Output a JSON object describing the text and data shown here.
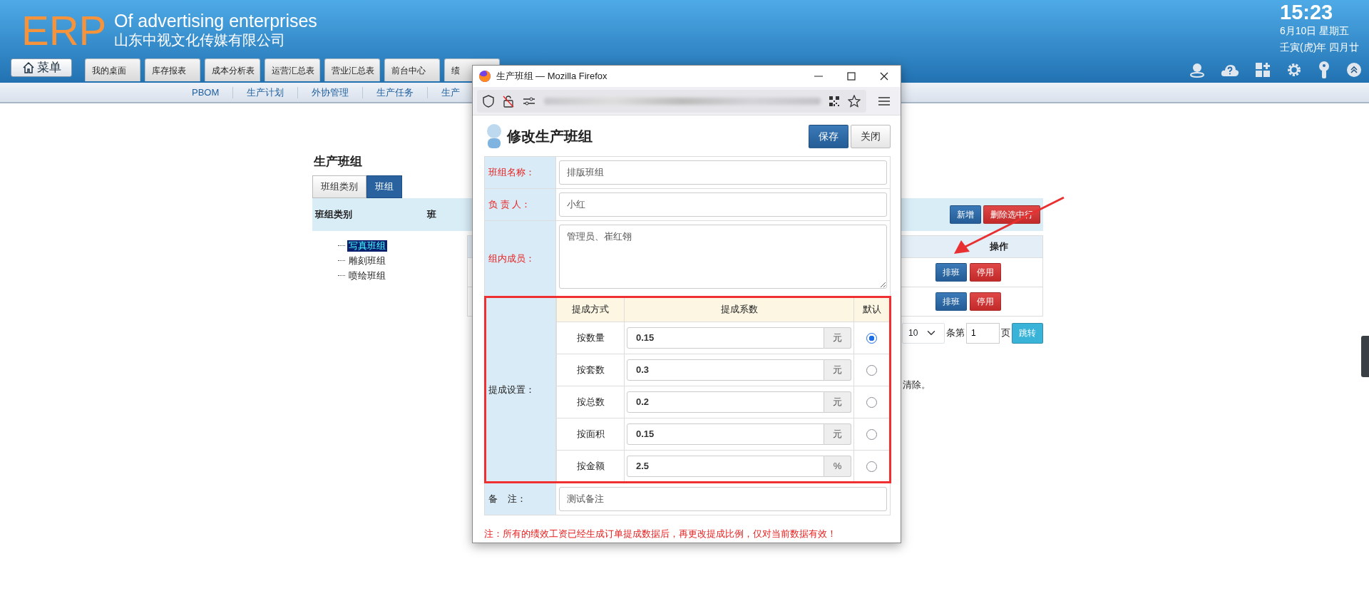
{
  "header": {
    "logo": "ERP",
    "title": "Of advertising enterprises",
    "company": "山东中视文化传媒有限公司",
    "menu_button": "菜单",
    "clock": {
      "time": "15:23",
      "date": "6月10日 星期五",
      "lunar": "壬寅(虎)年 四月廿"
    }
  },
  "tabs": [
    {
      "label": "我的桌面"
    },
    {
      "label": "库存报表"
    },
    {
      "label": "成本分析表"
    },
    {
      "label": "运营汇总表"
    },
    {
      "label": "营业汇总表"
    },
    {
      "label": "前台中心"
    },
    {
      "label": "绩"
    }
  ],
  "subnav": [
    "PBOM",
    "生产计划",
    "外协管理",
    "生产任务",
    "生产"
  ],
  "page": {
    "title": "生产班组",
    "tabs": [
      {
        "label": "班组类别",
        "selected": false
      },
      {
        "label": "班组",
        "selected": true
      }
    ],
    "tree_heading": "班组类别",
    "list_heading": "班",
    "buttons": [
      {
        "label": "新增",
        "kind": "primary"
      },
      {
        "label": "删除选中行",
        "kind": "danger"
      }
    ],
    "tree": [
      {
        "label": "写真班组",
        "selected": true
      },
      {
        "label": "雕刻班组",
        "selected": false
      },
      {
        "label": "喷绘班组",
        "selected": false
      }
    ],
    "table": {
      "columns": [
        "操作"
      ],
      "rows": [
        {
          "actions": [
            {
              "label": "排班",
              "kind": "primary"
            },
            {
              "label": "停用",
              "kind": "danger"
            }
          ]
        },
        {
          "actions": [
            {
              "label": "排班",
              "kind": "primary"
            },
            {
              "label": "停用",
              "kind": "danger"
            }
          ]
        }
      ]
    },
    "pagination": {
      "page_size": "10",
      "before_input": "条第",
      "page": "1",
      "after_input": "页",
      "jump": "跳转"
    },
    "notice": "清除。"
  },
  "popup": {
    "window_title": "生产班组 — Mozilla Firefox",
    "heading": "修改生产班组",
    "buttons": [
      {
        "label": "保存",
        "kind": "primary"
      },
      {
        "label": "关闭",
        "kind": "default"
      }
    ],
    "fields": [
      {
        "kind": "input",
        "label": "班组名称：",
        "required": true,
        "value": "排版班组"
      },
      {
        "kind": "input",
        "label": "负 责 人：",
        "required": true,
        "value": "小红"
      },
      {
        "kind": "textarea",
        "label": "组内成员：",
        "required": true,
        "value": "管理员、崔红翎"
      },
      {
        "kind": "commission",
        "label": "提成设置：",
        "required": false
      },
      {
        "kind": "input",
        "label": "备    注：",
        "required": false,
        "value": "测试备注"
      }
    ],
    "commission": {
      "columns": [
        "提成方式",
        "提成系数",
        "默认"
      ],
      "rows": [
        {
          "method": "按数量",
          "value": "0.15",
          "unit": "元",
          "selected": true
        },
        {
          "method": "按套数",
          "value": "0.3",
          "unit": "元",
          "selected": false
        },
        {
          "method": "按总数",
          "value": "0.2",
          "unit": "元",
          "selected": false
        },
        {
          "method": "按面积",
          "value": "0.15",
          "unit": "元",
          "selected": false
        },
        {
          "method": "按金额",
          "value": "2.5",
          "unit": "%",
          "selected": false
        }
      ]
    },
    "note": "注：所有的绩效工资已经生成订单提成数据后，再更改提成比例，仅对当前数据有效！"
  }
}
